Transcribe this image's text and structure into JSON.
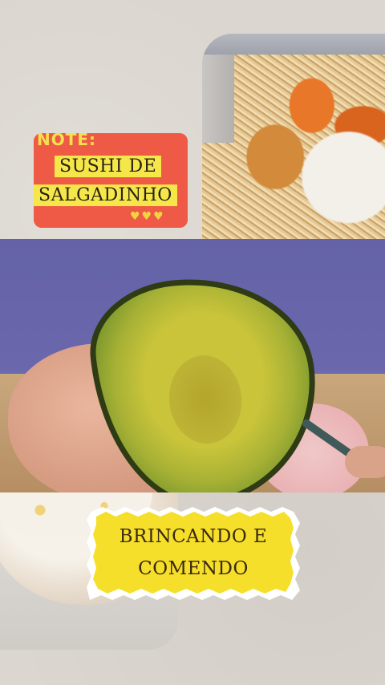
{
  "labels": {
    "note": "NOTE:",
    "title_line1": "SUSHI DE",
    "title_line2": "SALGADINHO",
    "hearts": "♥♥♥",
    "caption_line1": "BRINCANDO E",
    "caption_line2": "COMENDO"
  },
  "colors": {
    "background": "#dbd6cf",
    "sticker_red": "#ef5a46",
    "sticker_yellow": "#f5e74a",
    "burst_yellow": "#f6df2a"
  },
  "images": {
    "top": "snack-on-rice photo",
    "middle": "halved avocado in hand",
    "bottom": "bowl of rice"
  }
}
